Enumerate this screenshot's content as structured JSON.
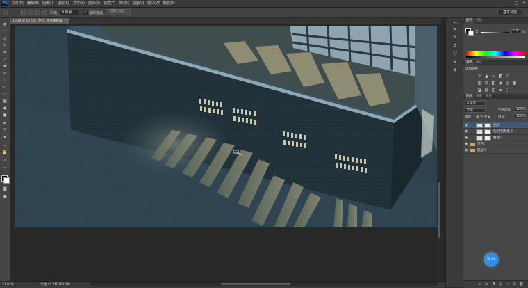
{
  "app": {
    "logo": "Ps"
  },
  "menu": [
    "文件(F)",
    "编辑(E)",
    "图像(I)",
    "图层(L)",
    "文字(Y)",
    "选择(S)",
    "滤镜(T)",
    "3D(D)",
    "视图(V)",
    "窗口(W)",
    "帮助(H)"
  ],
  "window_controls": {
    "minimize": "–",
    "maximize": "▢",
    "close": "✕"
  },
  "options": {
    "feather_label": "羽化:",
    "feather_value": "0 像素",
    "antialias_label": "消除锯齿",
    "refine_edge": "调整边缘...",
    "workspace": "基本功能"
  },
  "document": {
    "tab_title": "1.psd @ 57.5% (色阶, 图层蒙版/8) *",
    "tab_close": "×",
    "zoom": "57.03%",
    "doc_info": "文档:40.7M/289.1M"
  },
  "panels": {
    "color_tabs": [
      "颜色",
      "色板"
    ],
    "k_label": "K",
    "k_value": "100",
    "k_unit": "%",
    "adjust_tabs": [
      "调整",
      "样式"
    ],
    "adjust_title": "添加调整",
    "layers_tabs": [
      "图层",
      "通道",
      "路径"
    ],
    "kind_filter": "ρ 类型",
    "blend_mode": "正常",
    "opacity_label": "不透明度:",
    "opacity_value": "100%",
    "lock_label": "锁定:",
    "fill_label": "填充:",
    "fill_value": "100%",
    "layers": [
      {
        "name": "色阶",
        "selected": true,
        "kind": "adjustment"
      },
      {
        "name": "色相/饱和度 1",
        "selected": false,
        "kind": "adjustment"
      },
      {
        "name": "曲线 1",
        "selected": false,
        "kind": "adjustment"
      },
      {
        "name": "室内",
        "selected": false,
        "kind": "group"
      },
      {
        "name": "图层 0",
        "selected": false,
        "kind": "group"
      }
    ],
    "footer_icons": [
      "link-icon",
      "fx-icon",
      "mask-icon",
      "adjustment-icon",
      "folder-icon",
      "new-layer-icon",
      "trash-icon"
    ]
  },
  "floating_badge": "00:14"
}
